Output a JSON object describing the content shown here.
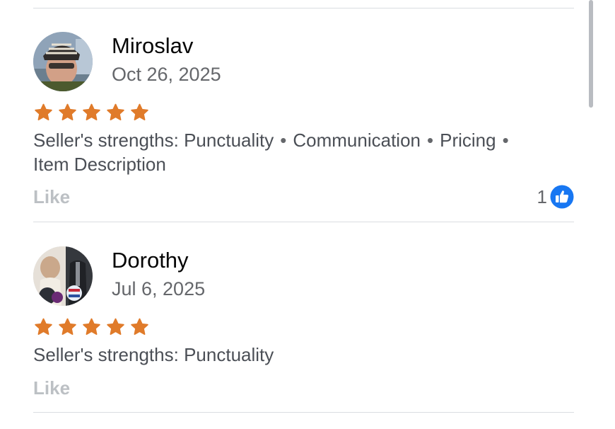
{
  "reviews": [
    {
      "name": "Miroslav",
      "date": "Oct 26, 2025",
      "rating": 5,
      "strengths_prefix": "Seller's strengths:",
      "strengths": [
        "Punctuality",
        "Communication",
        "Pricing",
        "Item Description"
      ],
      "like_label": "Like",
      "like_count": "1",
      "avatar_icon": "avatar-photo-icon"
    },
    {
      "name": "Dorothy",
      "date": "Jul 6, 2025",
      "rating": 5,
      "strengths_prefix": "Seller's strengths:",
      "strengths": [
        "Punctuality"
      ],
      "like_label": "Like",
      "avatar_icon": "avatar-photo-icon"
    }
  ],
  "colors": {
    "star": "#e07b2a",
    "like_badge": "#1877f2",
    "divider": "#dadde1",
    "muted_text": "#65676b",
    "like_text": "#bcc0c4"
  }
}
